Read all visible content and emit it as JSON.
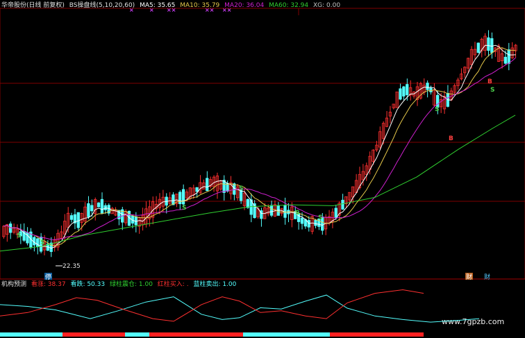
{
  "header": {
    "stock": "华帝股份(日线 前复权)",
    "indicator": "BS操盘线(5,10,20,60)",
    "ma5": "MA5: 35.65",
    "ma10": "MA10: 35.79",
    "ma20": "MA20: 36.04",
    "ma60": "MA60: 32.94",
    "xg": "XG: 0.00"
  },
  "lower": {
    "name": "机构预测",
    "bull": "看涨: 38.37",
    "bear": "看跌: 50.33",
    "green_hold": "绿柱震仓: 1.00",
    "red_buy": "红柱买入: .",
    "blue_sell": "蓝柱卖出: 1.00"
  },
  "labels": {
    "low_price": "22.35",
    "s_mark": "S",
    "b_mark": "B",
    "stop_badge": "停",
    "fin_badge": "财",
    "x_mark": "×",
    "xx_mark": "××"
  },
  "watermark": "www.7gpzb.com",
  "colors": {
    "bg": "#000000",
    "grid": "#800000",
    "up": "#ff3030",
    "down": "#54ffff",
    "ma5": "#ffffff",
    "ma10": "#e6c84a",
    "ma20": "#d020d0",
    "ma60": "#30d030",
    "s": "#4cd04c",
    "b": "#ff4040",
    "x": "#d040ff"
  },
  "chart_data": {
    "type": "candlestick",
    "ylim": [
      20,
      48
    ],
    "low_annotation": 22.35,
    "series": [
      {
        "name": "MA5",
        "last": 35.65
      },
      {
        "name": "MA10",
        "last": 35.79
      },
      {
        "name": "MA20",
        "last": 36.04
      },
      {
        "name": "MA60",
        "last": 32.94
      }
    ],
    "keypoints": [
      [
        0,
        24.5
      ],
      [
        12,
        25.0
      ],
      [
        22,
        24.6
      ],
      [
        40,
        23.8
      ],
      [
        58,
        23.2
      ],
      [
        70,
        22.8
      ],
      [
        84,
        23.9
      ],
      [
        98,
        26.2
      ],
      [
        112,
        25.8
      ],
      [
        126,
        27.0
      ],
      [
        140,
        27.5
      ],
      [
        155,
        27.0
      ],
      [
        170,
        26.4
      ],
      [
        185,
        26.0
      ],
      [
        200,
        25.6
      ],
      [
        215,
        26.8
      ],
      [
        230,
        27.8
      ],
      [
        245,
        28.0
      ],
      [
        260,
        28.3
      ],
      [
        275,
        28.9
      ],
      [
        290,
        29.5
      ],
      [
        305,
        30.0
      ],
      [
        320,
        29.5
      ],
      [
        335,
        29.2
      ],
      [
        345,
        28.5
      ],
      [
        355,
        27.6
      ],
      [
        365,
        26.8
      ],
      [
        375,
        26.4
      ],
      [
        385,
        26.9
      ],
      [
        395,
        26.9
      ],
      [
        405,
        26.8
      ],
      [
        415,
        26.7
      ],
      [
        425,
        26.3
      ],
      [
        435,
        25.6
      ],
      [
        445,
        25.4
      ],
      [
        455,
        25.6
      ],
      [
        465,
        25.4
      ],
      [
        475,
        26.1
      ],
      [
        485,
        26.9
      ],
      [
        495,
        27.9
      ],
      [
        505,
        28.8
      ],
      [
        515,
        30.0
      ],
      [
        525,
        31.2
      ],
      [
        535,
        32.8
      ],
      [
        545,
        34.6
      ],
      [
        555,
        36.5
      ],
      [
        565,
        38.3
      ],
      [
        575,
        39.6
      ],
      [
        585,
        40.0
      ],
      [
        595,
        39.4
      ],
      [
        605,
        39.9
      ],
      [
        615,
        40.4
      ],
      [
        625,
        38.8
      ],
      [
        635,
        38.4
      ],
      [
        645,
        39.0
      ],
      [
        655,
        40.4
      ],
      [
        665,
        41.8
      ],
      [
        675,
        43.3
      ],
      [
        685,
        44.4
      ],
      [
        695,
        45.0
      ],
      [
        705,
        44.8
      ],
      [
        715,
        43.9
      ],
      [
        725,
        43.1
      ],
      [
        735,
        43.9
      ],
      [
        745,
        45.0
      ]
    ],
    "ma60_keypoints": [
      [
        0,
        22.5
      ],
      [
        60,
        23.0
      ],
      [
        120,
        24.2
      ],
      [
        180,
        25.0
      ],
      [
        240,
        25.8
      ],
      [
        300,
        26.6
      ],
      [
        360,
        27.3
      ],
      [
        420,
        27.5
      ],
      [
        480,
        27.4
      ],
      [
        540,
        28.3
      ],
      [
        600,
        30.5
      ],
      [
        660,
        33.5
      ],
      [
        710,
        35.8
      ],
      [
        742,
        37.2
      ]
    ],
    "lower_bull": [
      [
        0,
        62
      ],
      [
        40,
        58
      ],
      [
        80,
        50
      ],
      [
        100,
        42
      ],
      [
        130,
        30
      ],
      [
        170,
        48
      ],
      [
        210,
        68
      ],
      [
        250,
        80
      ],
      [
        290,
        40
      ],
      [
        320,
        28
      ],
      [
        345,
        32
      ],
      [
        375,
        55
      ],
      [
        405,
        52
      ],
      [
        440,
        70
      ],
      [
        470,
        84
      ],
      [
        500,
        54
      ],
      [
        540,
        36
      ],
      [
        580,
        28
      ],
      [
        620,
        22
      ],
      [
        660,
        26
      ],
      [
        690,
        30
      ]
    ],
    "lower_bear": [
      [
        0,
        36
      ],
      [
        40,
        44
      ],
      [
        80,
        62
      ],
      [
        110,
        78
      ],
      [
        140,
        72
      ],
      [
        180,
        50
      ],
      [
        220,
        30
      ],
      [
        250,
        24
      ],
      [
        290,
        62
      ],
      [
        320,
        80
      ],
      [
        345,
        70
      ],
      [
        375,
        44
      ],
      [
        405,
        48
      ],
      [
        440,
        36
      ],
      [
        470,
        30
      ],
      [
        500,
        66
      ],
      [
        540,
        88
      ],
      [
        580,
        96
      ],
      [
        610,
        88
      ]
    ],
    "lower_bar_segments": [
      {
        "from": 0,
        "to": 90,
        "color": "blue"
      },
      {
        "from": 90,
        "to": 180,
        "color": "red"
      },
      {
        "from": 180,
        "to": 215,
        "color": "blue"
      },
      {
        "from": 215,
        "to": 350,
        "color": "red"
      },
      {
        "from": 350,
        "to": 475,
        "color": "blue"
      },
      {
        "from": 475,
        "to": 610,
        "color": "red"
      }
    ]
  }
}
